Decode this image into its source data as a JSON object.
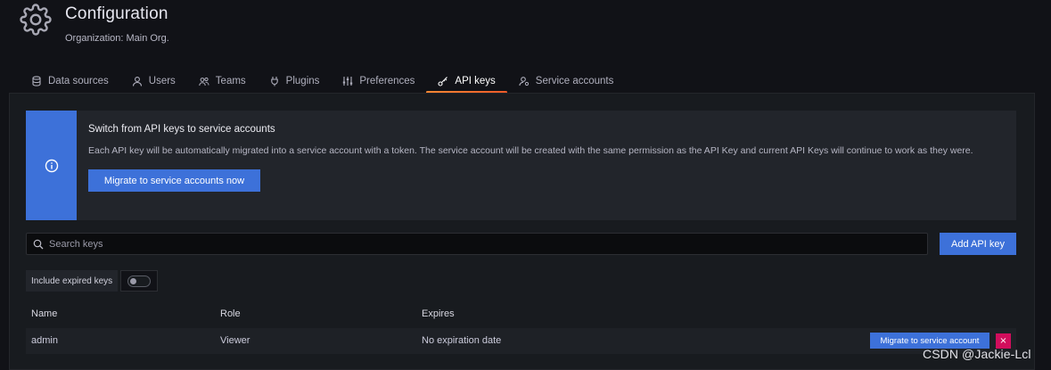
{
  "header": {
    "icon": "gear-icon",
    "title": "Configuration",
    "subtitle": "Organization: Main Org."
  },
  "tabs": [
    {
      "label": "Data sources",
      "icon": "database-icon",
      "active": false
    },
    {
      "label": "Users",
      "icon": "user-icon",
      "active": false
    },
    {
      "label": "Teams",
      "icon": "users-icon",
      "active": false
    },
    {
      "label": "Plugins",
      "icon": "plug-icon",
      "active": false
    },
    {
      "label": "Preferences",
      "icon": "sliders-icon",
      "active": false
    },
    {
      "label": "API keys",
      "icon": "key-icon",
      "active": true
    },
    {
      "label": "Service accounts",
      "icon": "service-account-icon",
      "active": false
    }
  ],
  "alert": {
    "icon": "info-circle-icon",
    "title": "Switch from API keys to service accounts",
    "text": "Each API key will be automatically migrated into a service account with a token. The service account will be created with the same permission as the API Key and current API Keys will continue to work as they were.",
    "button": "Migrate to service accounts now"
  },
  "search": {
    "placeholder": "Search keys",
    "value": ""
  },
  "add_button": "Add API key",
  "include_expired": {
    "label": "Include expired keys",
    "checked": false
  },
  "table": {
    "columns": [
      "Name",
      "Role",
      "Expires"
    ],
    "rows": [
      {
        "name": "admin",
        "role": "Viewer",
        "expires": "No expiration date",
        "migrate_label": "Migrate to service account",
        "delete_label": "×"
      }
    ]
  },
  "watermark": "CSDN @Jackie-Lcl",
  "colors": {
    "accent": "#3d71d9",
    "danger": "#d10e5c",
    "tab_active": "#f05a28",
    "background": "#111217"
  }
}
